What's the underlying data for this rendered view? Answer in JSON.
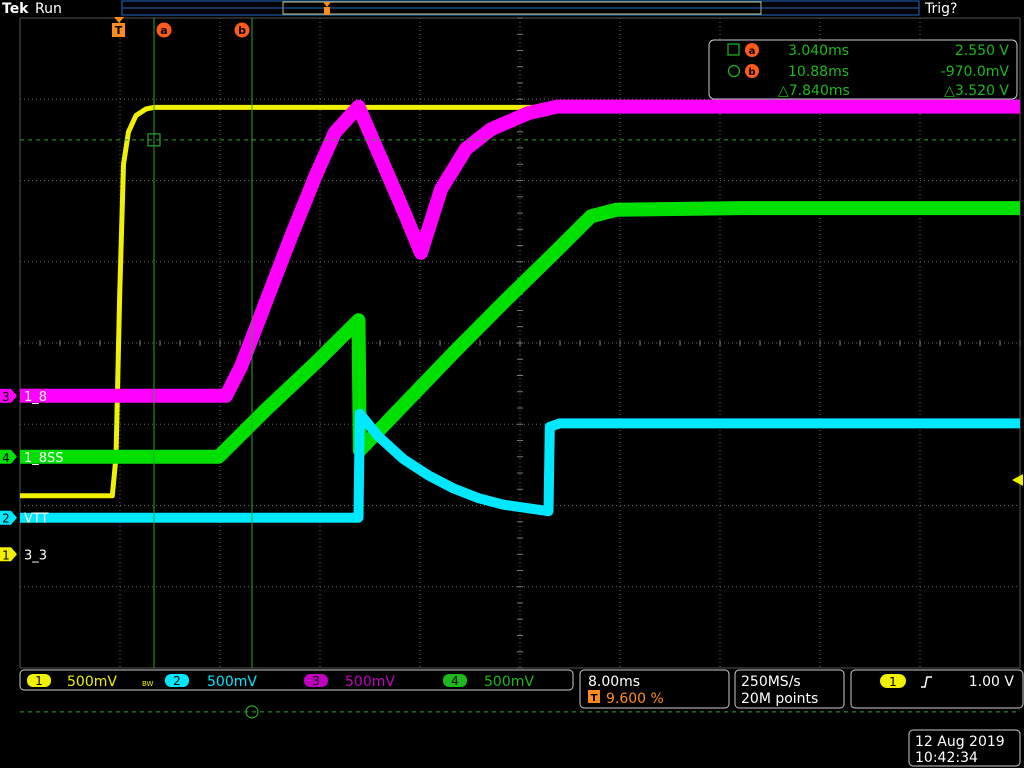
{
  "header": {
    "brand": "Tek",
    "run_state": "Run",
    "trigger_state": "Trig?"
  },
  "markers": {
    "trigger": "T",
    "cursor_a": "a",
    "cursor_b": "b"
  },
  "cursor_readout": {
    "a_time": "3.040ms",
    "a_value": "2.550 V",
    "b_time": "10.88ms",
    "b_value": "-970.0mV",
    "delta_time": "△7.840ms",
    "delta_value": "△3.520 V"
  },
  "channel_labels": [
    {
      "num": "3",
      "name": "1_8",
      "color": "#ff00ff"
    },
    {
      "num": "4",
      "name": "1_8SS",
      "color": "#00e000"
    },
    {
      "num": "2",
      "name": "VTT",
      "color": "#00e8ff"
    },
    {
      "num": "1",
      "name": "3_3",
      "color": "#f0f000"
    }
  ],
  "status": {
    "ch1": {
      "num": "1",
      "scale": "500mV",
      "color": "#f0f000"
    },
    "bw": "BW",
    "ch2": {
      "num": "2",
      "scale": "500mV",
      "color": "#00e8ff"
    },
    "ch3": {
      "num": "3",
      "scale": "500mV",
      "color": "#ff00ff"
    },
    "ch4": {
      "num": "4",
      "scale": "500mV",
      "color": "#00e000"
    },
    "timebase": "8.00ms",
    "trigger_position": "9.600 %",
    "sample_rate": "250MS/s",
    "record_length": "20M points",
    "trigger_source": "1",
    "trigger_level": "1.00 V"
  },
  "datetime": {
    "date": "12 Aug 2019",
    "time": "10:42:34"
  },
  "chart_data": {
    "type": "line",
    "title": "",
    "xlabel": "",
    "ylabel": "",
    "x_unit": "ms",
    "divisions": {
      "x": 10,
      "y": 8
    },
    "time_per_div_ms": 8.0,
    "volts_per_div": 0.5,
    "trigger_position_percent": 9.6,
    "xlim_ms": [
      -7.68,
      72.32
    ],
    "ylim_div": [
      -4,
      4
    ],
    "grid": true,
    "cursors": [
      {
        "name": "a",
        "time_ms": 3.04
      },
      {
        "name": "b",
        "time_ms": 10.88
      }
    ],
    "series": [
      {
        "name": "3_3",
        "channel": 1,
        "color": "#f0f000",
        "offset_div": -2.6,
        "x": [
          -7.68,
          -7.2,
          -0.3,
          0,
          0.3,
          0.6,
          1.0,
          1.6,
          2.4,
          3.0,
          10,
          20,
          30,
          40,
          50,
          60,
          72.32
        ],
        "y": [
          0.36,
          0.36,
          0.36,
          0.6,
          1.6,
          2.4,
          2.6,
          2.7,
          2.74,
          2.75,
          2.75,
          2.75,
          2.75,
          2.75,
          2.75,
          2.75,
          2.75
        ]
      },
      {
        "name": "1_8",
        "channel": 3,
        "color": "#ff00ff",
        "offset_div": -0.65,
        "x": [
          -7.68,
          8.8,
          10,
          12,
          14,
          16,
          17.5,
          19.4,
          23,
          24.4,
          26,
          28,
          30,
          33,
          35.3,
          50,
          72.32
        ],
        "y": [
          0,
          0,
          0.18,
          0.58,
          0.98,
          1.36,
          1.62,
          1.78,
          1.14,
          0.88,
          1.27,
          1.52,
          1.64,
          1.74,
          1.78,
          1.78,
          1.78
        ]
      },
      {
        "name": "1_8SS",
        "channel": 4,
        "color": "#00e000",
        "offset_div": -1.4,
        "x": [
          -7.68,
          8.2,
          12,
          16,
          19.4,
          19.5,
          23,
          27,
          31,
          35,
          38,
          40,
          50,
          60,
          72.32
        ],
        "y": [
          0,
          0,
          0.29,
          0.58,
          0.84,
          0.04,
          0.32,
          0.64,
          0.95,
          1.25,
          1.48,
          1.52,
          1.53,
          1.53,
          1.53
        ]
      },
      {
        "name": "VTT",
        "channel": 2,
        "color": "#00e8ff",
        "offset_div": -2.15,
        "x": [
          -7.68,
          19.4,
          19.5,
          21,
          23,
          25,
          27,
          29,
          31,
          34.6,
          34.7,
          35.5,
          40,
          50,
          60,
          72.32
        ],
        "y": [
          0,
          0,
          0.64,
          0.5,
          0.36,
          0.26,
          0.18,
          0.12,
          0.08,
          0.04,
          0.56,
          0.58,
          0.58,
          0.58,
          0.58,
          0.58
        ]
      }
    ]
  }
}
